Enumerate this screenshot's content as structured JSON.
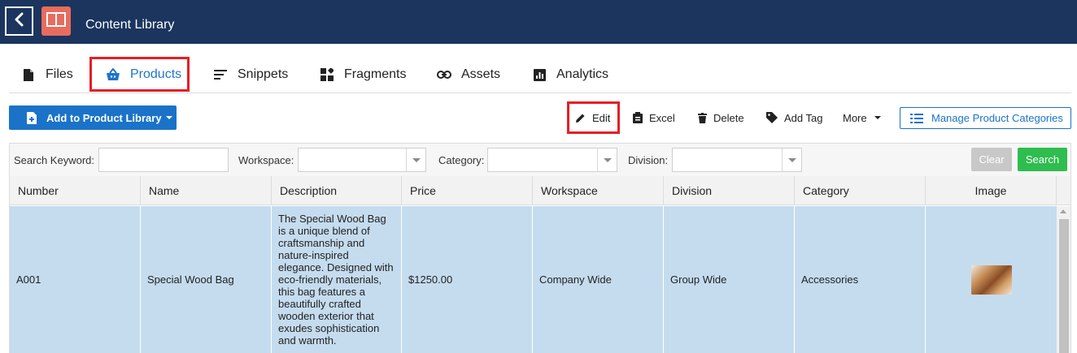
{
  "header": {
    "title": "Content Library"
  },
  "colors": {
    "header_bg": "#1b355f",
    "accent": "#1a73c8",
    "logo": "#e86c5e",
    "highlight": "#e41f26",
    "search": "#2ebd4e",
    "row_selected": "#c5dcef"
  },
  "tabs": [
    {
      "label": "Files",
      "icon": "file-icon"
    },
    {
      "label": "Products",
      "icon": "basket-icon",
      "active": true
    },
    {
      "label": "Snippets",
      "icon": "lines-icon"
    },
    {
      "label": "Fragments",
      "icon": "fragments-icon"
    },
    {
      "label": "Assets",
      "icon": "link-icon"
    },
    {
      "label": "Analytics",
      "icon": "chart-icon"
    }
  ],
  "toolbar": {
    "add_label": "Add to Product Library",
    "edit_label": "Edit",
    "excel_label": "Excel",
    "delete_label": "Delete",
    "tag_label": "Add Tag",
    "more_label": "More",
    "manage_label": "Manage Product Categories"
  },
  "filters": {
    "keyword_label": "Search Keyword:",
    "keyword_value": "",
    "workspace_label": "Workspace:",
    "workspace_value": "",
    "category_label": "Category:",
    "category_value": "",
    "division_label": "Division:",
    "division_value": "",
    "clear_label": "Clear",
    "search_label": "Search"
  },
  "table": {
    "columns": [
      "Number",
      "Name",
      "Description",
      "Price",
      "Workspace",
      "Division",
      "Category",
      "Image"
    ],
    "rows": [
      {
        "number": "A001",
        "name": "Special Wood Bag",
        "description": "The Special Wood Bag is a unique blend of craftsmanship and nature-inspired elegance. Designed with eco-friendly materials, this bag features a beautifully crafted wooden exterior that exudes sophistication and warmth.",
        "price": "$1250.00",
        "workspace": "Company Wide",
        "division": "Group Wide",
        "category": "Accessories",
        "image": "wood-bag-thumbnail"
      }
    ]
  }
}
